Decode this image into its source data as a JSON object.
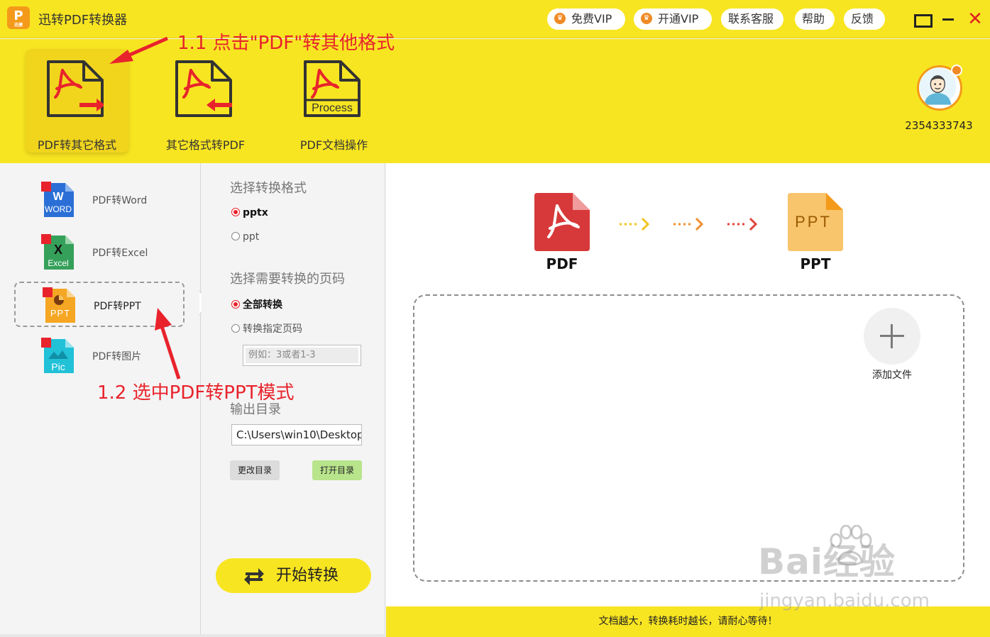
{
  "app": {
    "logo_text": "P",
    "logo_subtext": "迅捷",
    "title": "迅转PDF转换器"
  },
  "topbar": {
    "free_vip": "免费VIP",
    "open_vip": "开通VIP",
    "contact": "联系客服",
    "help": "帮助",
    "feedback": "反馈",
    "maximize_icon": "maximize-icon",
    "minimize_icon": "minimize-icon",
    "close_icon": "close-icon",
    "close_glyph": "✕"
  },
  "modes": [
    {
      "label": "PDF转其它格式",
      "active": true
    },
    {
      "label": "其它格式转PDF",
      "active": false
    },
    {
      "label": "PDF文档操作",
      "active": false,
      "icon_text": "Process"
    }
  ],
  "user": {
    "id": "2354333743"
  },
  "annotations": {
    "step1": "1.1 点击\"PDF\"转其他格式",
    "step2": "1.2 选中PDF转PPT模式"
  },
  "sidebar": {
    "items": [
      {
        "label": "PDF转Word",
        "icon_text": "WORD",
        "icon_color": "#2b6fd6"
      },
      {
        "label": "PDF转Excel",
        "icon_text": "Excel",
        "icon_color": "#35a05a"
      },
      {
        "label": "PDF转PPT",
        "icon_text": "PPT",
        "icon_color": "#f5a623",
        "active": true
      },
      {
        "label": "PDF转图片",
        "icon_text": "Pic",
        "icon_color": "#21c1d8"
      }
    ]
  },
  "settings": {
    "format_title": "选择转换格式",
    "formats": [
      {
        "label": "pptx",
        "checked": true
      },
      {
        "label": "ppt",
        "checked": false
      }
    ],
    "pages_title": "选择需要转换的页码",
    "pages_options": [
      {
        "label": "全部转换",
        "checked": true
      },
      {
        "label": "转换指定页码",
        "checked": false
      }
    ],
    "pages_placeholder": "例如：3或者1-3",
    "output_title": "输出目录",
    "output_path": "C:\\Users\\win10\\Desktop",
    "change_dir": "更改目录",
    "open_dir": "打开目录",
    "start": "开始转换"
  },
  "main": {
    "from_label": "PDF",
    "to_label": "PPT",
    "ppt_icon_text": "PPT",
    "arrow_colors": [
      "#f2c31d",
      "#ef8f2e",
      "#e0443c"
    ],
    "add_file": "添加文件"
  },
  "footer": {
    "notice": "文档越大，转换耗时越长，请耐心等待！"
  },
  "watermark": {
    "text": "Bai经验",
    "url": "jingyan.baidu.com"
  }
}
